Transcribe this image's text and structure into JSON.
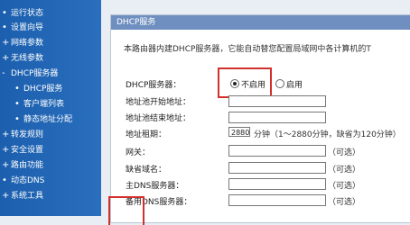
{
  "sidebar": {
    "items": [
      {
        "label": "运行状态",
        "bullet": "•",
        "level": "top"
      },
      {
        "label": "设置向导",
        "bullet": "•",
        "level": "top"
      },
      {
        "label": "网络参数",
        "bullet": "+",
        "level": "top"
      },
      {
        "label": "无线参数",
        "bullet": "+",
        "level": "top"
      },
      {
        "label": "DHCP服务器",
        "bullet": "-",
        "level": "top"
      },
      {
        "label": "DHCP服务",
        "bullet": "•",
        "level": "sub"
      },
      {
        "label": "客户端列表",
        "bullet": "•",
        "level": "sub"
      },
      {
        "label": "静态地址分配",
        "bullet": "•",
        "level": "sub"
      },
      {
        "label": "转发规则",
        "bullet": "+",
        "level": "top"
      },
      {
        "label": "安全设置",
        "bullet": "+",
        "level": "top"
      },
      {
        "label": "路由功能",
        "bullet": "+",
        "level": "top"
      },
      {
        "label": "动态DNS",
        "bullet": "•",
        "level": "top"
      },
      {
        "label": "系统工具",
        "bullet": "+",
        "level": "top"
      }
    ]
  },
  "panel": {
    "title": "DHCP服务",
    "intro": "本路由器内建DHCP服务器，它能自动替您配置局域网中各计算机的T"
  },
  "form": {
    "dhcp_label": "DHCP服务器：",
    "dhcp_options": [
      {
        "label": "不启用",
        "checked": true
      },
      {
        "label": "启用",
        "checked": false
      }
    ],
    "pool_start_label": "地址池开始地址：",
    "pool_end_label": "地址池结束地址：",
    "lease_label": "地址租期：",
    "lease_value": "2880",
    "lease_hint": "分钟（1～2880分钟，缺省为120分钟）",
    "gateway_label": "网关：",
    "domain_label": "缺省域名：",
    "dns_primary_label": "主DNS服务器：",
    "dns_secondary_label": "备用DNS服务器：",
    "optional_hint": "（可选）"
  },
  "colors": {
    "sidebar": "#1b5fae",
    "panel_title": "#6e8fbf",
    "highlight": "#d0312d"
  }
}
